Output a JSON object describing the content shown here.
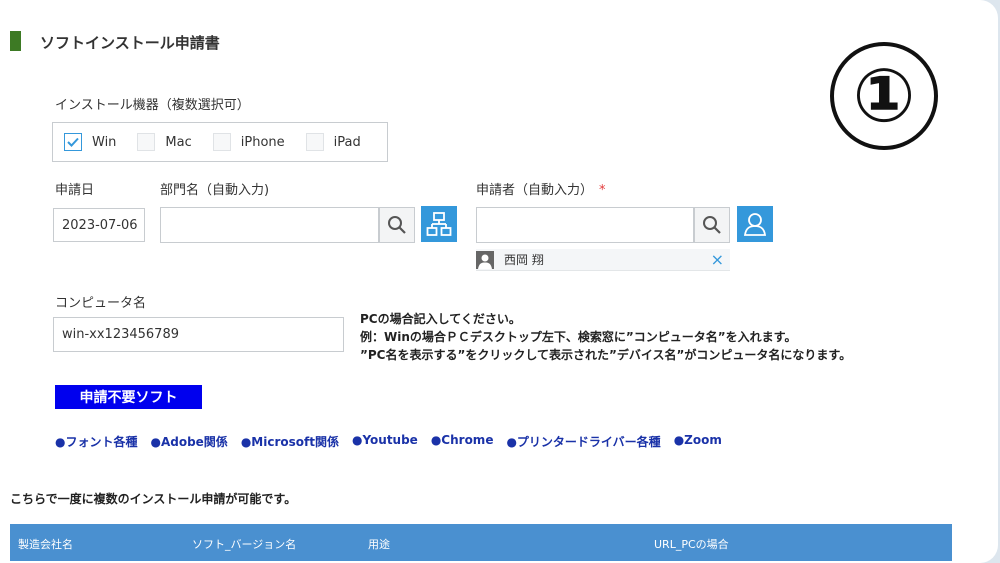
{
  "form": {
    "title": "ソフトインストール申請書",
    "step_number": "①"
  },
  "devices": {
    "label": "インストール機器（複数選択可）",
    "options": [
      {
        "label": "Win",
        "checked": true
      },
      {
        "label": "Mac",
        "checked": false
      },
      {
        "label": "iPhone",
        "checked": false
      },
      {
        "label": "iPad",
        "checked": false
      }
    ]
  },
  "application_date": {
    "label": "申請日",
    "value": "2023-07-06"
  },
  "department": {
    "label": "部門名（自動入力)",
    "value": ""
  },
  "applicant": {
    "label": "申請者（自動入力）",
    "required_mark": "*",
    "value": "",
    "selected_user": "西岡 翔",
    "remove_icon": "×"
  },
  "computer_name": {
    "label": "コンピュータ名",
    "value": "win-xx123456789"
  },
  "note": {
    "line1": "PCの場合記入してください。",
    "line2": "例：Winの場合ＰＣデスクトップ左下、検索窓に”コンピュータ名”を入れます。",
    "line3": "”PC名を表示する”をクリックして表示された”デバイス名”がコンピュータ名になります。"
  },
  "no_application": {
    "badge": "申請不要ソフト",
    "items": [
      "●フォント各種",
      "●Adobe関係",
      "●Microsoft関係",
      "●Youtube",
      "●Chrome",
      "●プリンタードライバー各種",
      "●Zoom"
    ]
  },
  "info_text": "こちらで一度に複数のインストール申請が可能です。",
  "table": {
    "headers": [
      "製造会社名",
      "ソフト_バージョン名",
      "用途",
      "URL_PCの場合"
    ]
  },
  "colors": {
    "accent": "#3498db",
    "title_bar": "#3d7a24",
    "table_header": "#4a90d0",
    "badge": "#0000ee",
    "link": "#1a32a8"
  }
}
